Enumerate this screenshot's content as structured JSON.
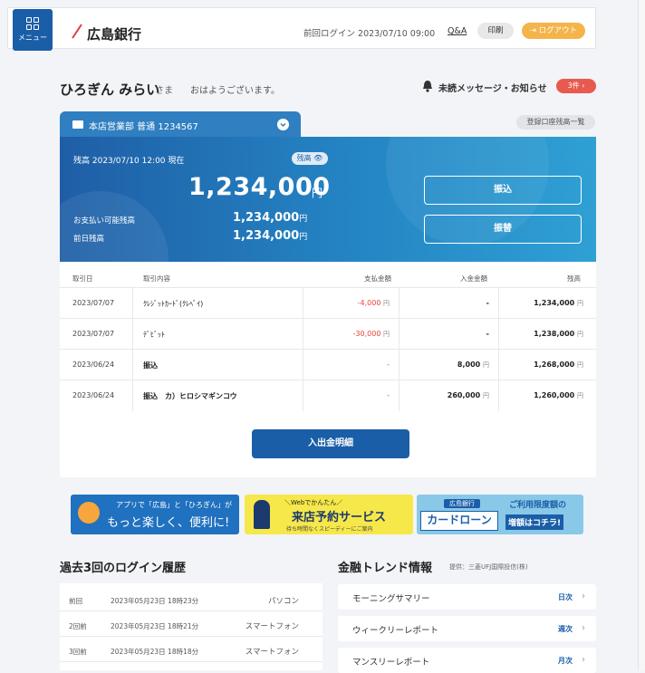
{
  "header": {
    "menu_label": "メニュー",
    "logo": "広島銀行",
    "last_login": "前回ログイン  2023/07/10 09:00",
    "qa": "Q&A",
    "print": "印刷",
    "logout": "ログアウト"
  },
  "greeting": {
    "name": "ひろぎん みらい",
    "suffix": "さま",
    "message": "おはようございます。",
    "unread_label": "未読メッセージ・お知らせ",
    "unread_badge": "3件 ›"
  },
  "account": {
    "label": "本店営業部 普通 1234567",
    "registered_list": "登録口座残高一覧",
    "balance_date": "残高  2023/07/10 12:00 現在",
    "balance_toggle": "残高 👁",
    "balance": "1,234,000",
    "balance_unit": "円",
    "available_label": "お支払い可能残高",
    "available": "1,234,000",
    "prev_label": "前日残高",
    "prev": "1,234,000",
    "small_unit": "円",
    "transfer_button": "振込",
    "furikae_button": "振替"
  },
  "transactions": {
    "headers": [
      "取引日",
      "取引内容",
      "支払金額",
      "入金金額",
      "残高"
    ],
    "rows": [
      {
        "date": "2023/07/07",
        "desc": "ｸﾚｼﾞｯﾄｶｰﾄﾞ(ｸﾚﾍﾞｲ)",
        "pay": "-4,000",
        "pay_unit": "円",
        "deposit": "-",
        "deposit_unit": "",
        "balance": "1,234,000",
        "balance_unit": "円"
      },
      {
        "date": "2023/07/07",
        "desc": "ﾃﾞﾋﾞｯﾄ",
        "pay": "-30,000",
        "pay_unit": "円",
        "deposit": "-",
        "deposit_unit": "",
        "balance": "1,238,000",
        "balance_unit": "円"
      },
      {
        "date": "2023/06/24",
        "desc": "振込",
        "pay": "-",
        "pay_unit": "",
        "deposit": "8,000",
        "deposit_unit": "円",
        "balance": "1,268,000",
        "balance_unit": "円"
      },
      {
        "date": "2023/06/24",
        "desc": "振込　カ）ヒロシマギンコウ",
        "pay": "-",
        "pay_unit": "",
        "deposit": "260,000",
        "deposit_unit": "円",
        "balance": "1,260,000",
        "balance_unit": "円"
      }
    ],
    "history_button": "入出金明細"
  },
  "banners": {
    "app_line1": "アプリで「広島」と「ひろぎん」が",
    "app_line2": "もっと楽しく、便利に!",
    "reserve_line1": "＼Webでかんたん／",
    "reserve_line2": "来店予約サービス",
    "reserve_line3": "待ち時間なくスピーディーにご案内",
    "loan_tag": "広島銀行",
    "loan_box": "カードローン",
    "loan_r1": "ご利用限度額の",
    "loan_r2": "増額はコチラ!"
  },
  "login_history": {
    "title": "過去3回のログイン履歴",
    "rows": [
      {
        "label": "前回",
        "datetime": "2023年05月23日 18時23分",
        "device": "パソコン"
      },
      {
        "label": "2回前",
        "datetime": "2023年05月23日 18時21分",
        "device": "スマートフォン"
      },
      {
        "label": "3回前",
        "datetime": "2023年05月23日 18時18分",
        "device": "スマートフォン"
      }
    ]
  },
  "trend": {
    "title": "金融トレンド情報",
    "source": "提供：三菱UFJ国際投信(株)",
    "rows": [
      {
        "title": "モーニングサマリー",
        "freq": "日次"
      },
      {
        "title": "ウィークリーレポート",
        "freq": "週次"
      },
      {
        "title": "マンスリーレポート",
        "freq": "月次"
      }
    ]
  },
  "colors": {
    "brand": "#1a5ea8",
    "accent": "#f5b44a",
    "negative": "#e8443a"
  }
}
